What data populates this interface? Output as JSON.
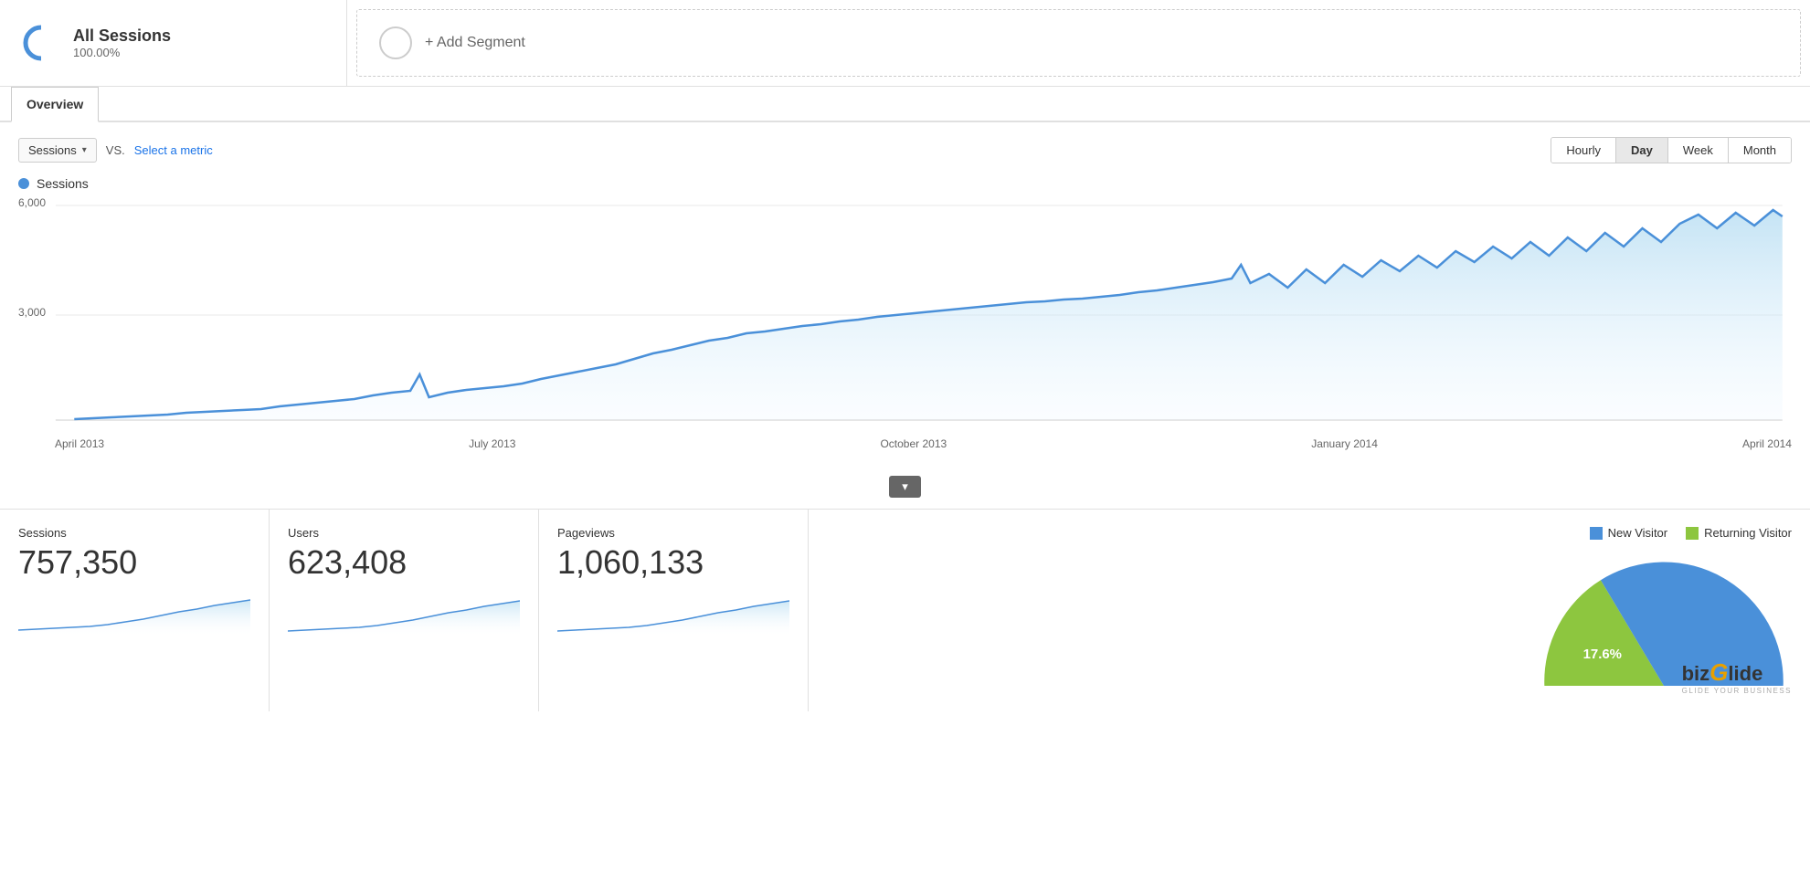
{
  "segment": {
    "title": "All Sessions",
    "percentage": "100.00%",
    "icon_color": "#4A90D9"
  },
  "add_segment": {
    "label": "+ Add Segment"
  },
  "tabs": {
    "active": "Overview",
    "items": [
      "Overview"
    ]
  },
  "chart_controls": {
    "metric_label": "Sessions",
    "vs_label": "VS.",
    "select_metric_label": "Select a metric",
    "time_buttons": [
      "Hourly",
      "Day",
      "Week",
      "Month"
    ],
    "active_time": "Day"
  },
  "legend": {
    "sessions_label": "Sessions"
  },
  "y_axis": {
    "values": [
      "6,000",
      "3,000",
      ""
    ]
  },
  "x_axis": {
    "labels": [
      "April 2013",
      "July 2013",
      "October 2013",
      "January 2014",
      "April 2014"
    ]
  },
  "stats": [
    {
      "label": "Sessions",
      "value": "757,350"
    },
    {
      "label": "Users",
      "value": "623,408"
    },
    {
      "label": "Pageviews",
      "value": "1,060,133"
    }
  ],
  "pie_chart": {
    "new_visitor_label": "New Visitor",
    "returning_visitor_label": "Returning Visitor",
    "new_visitor_color": "#4A90D9",
    "returning_visitor_color": "#8DC63F",
    "returning_pct": "17.6%",
    "new_pct": "82.4%"
  },
  "logo": {
    "text_biz": "biz",
    "text_G": "G",
    "text_lide": "lide",
    "sub": "GLIDE YOUR BUSINESS"
  }
}
